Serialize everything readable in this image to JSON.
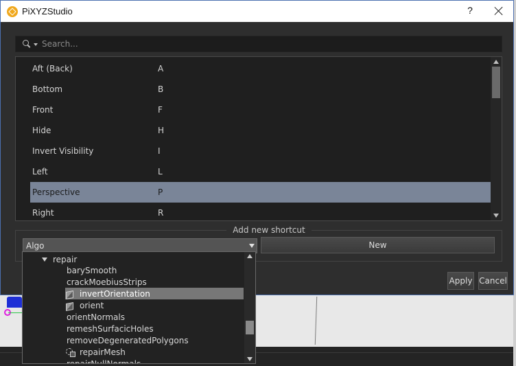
{
  "window": {
    "title": "PiXYZStudio",
    "help_label": "?"
  },
  "search": {
    "placeholder": "Search..."
  },
  "shortcuts": [
    {
      "name": "Aft (Back)",
      "key": "A"
    },
    {
      "name": "Bottom",
      "key": "B"
    },
    {
      "name": "Front",
      "key": "F"
    },
    {
      "name": "Hide",
      "key": "H"
    },
    {
      "name": "Invert Visibility",
      "key": "I"
    },
    {
      "name": "Left",
      "key": "L"
    },
    {
      "name": "Perspective",
      "key": "P"
    },
    {
      "name": "Right",
      "key": "R"
    }
  ],
  "selected_shortcut": "Perspective",
  "add_shortcut": {
    "group_title": "Add new shortcut",
    "category_value": "Algo",
    "new_button": "New"
  },
  "tree": {
    "parent": "repair",
    "items": [
      {
        "label": "barySmooth",
        "icon": ""
      },
      {
        "label": "crackMoebiusStrips",
        "icon": ""
      },
      {
        "label": "invertOrientation",
        "icon": "cube-icon",
        "selected": true
      },
      {
        "label": "orient",
        "icon": "cube-icon"
      },
      {
        "label": "orientNormals",
        "icon": ""
      },
      {
        "label": "remeshSurfacicHoles",
        "icon": ""
      },
      {
        "label": "removeDegeneratedPolygons",
        "icon": ""
      },
      {
        "label": "repairMesh",
        "icon": "repair-icon"
      },
      {
        "label": "repairNullNormals",
        "icon": ""
      }
    ]
  },
  "footer": {
    "apply": "Apply",
    "cancel": "Cancel"
  },
  "colors": {
    "dialog_bg": "#2e2e2e",
    "selection": "#7a8598",
    "window_border": "#4b6fb0"
  }
}
